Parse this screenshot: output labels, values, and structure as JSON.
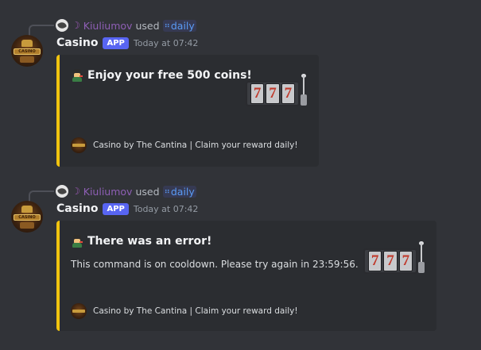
{
  "messages": [
    {
      "reply": {
        "moon": "☽",
        "user": "Kiuliumov",
        "used": "used",
        "command": "daily",
        "command_icon": "⠶"
      },
      "bot": {
        "name": "Casino",
        "badge": "APP",
        "timestamp": "Today at 07:42",
        "avatar_text": "CASINO"
      },
      "embed": {
        "title": "Enjoy your free 500 coins!",
        "description": "",
        "footer": "Casino by The Cantina | Claim your reward daily!",
        "slot": [
          "7",
          "7",
          "7"
        ]
      }
    },
    {
      "reply": {
        "moon": "☽",
        "user": "Kiuliumov",
        "used": "used",
        "command": "daily",
        "command_icon": "⠶"
      },
      "bot": {
        "name": "Casino",
        "badge": "APP",
        "timestamp": "Today at 07:42",
        "avatar_text": "CASINO"
      },
      "embed": {
        "title": "There was an error!",
        "description": "This command is on cooldown. Please try again in 23:59:56.",
        "footer": "Casino by The Cantina | Claim your reward daily!",
        "slot": [
          "7",
          "7",
          "7"
        ]
      }
    }
  ],
  "colors": {
    "embed_accent": "#f1c40f",
    "app_badge": "#5865f2",
    "background": "#313338",
    "embed_bg": "#2b2d31"
  }
}
